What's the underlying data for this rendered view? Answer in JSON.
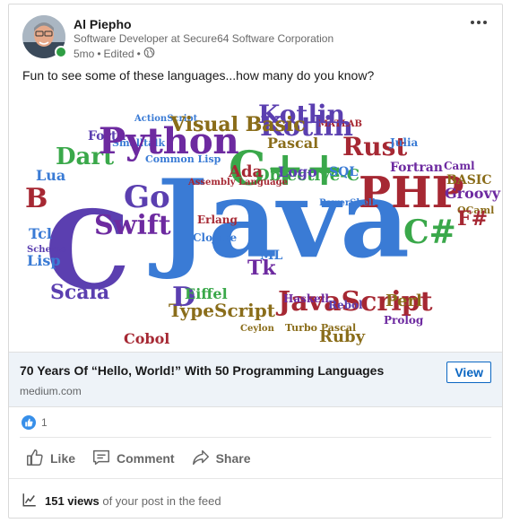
{
  "post": {
    "author": {
      "name": "Al Piepho",
      "headline": "Software Developer at Secure64 Software Corporation",
      "time": "5mo",
      "separator": "•",
      "edited": "Edited",
      "separator2": "•"
    },
    "text": "Fun to see some of these languages...how many do you know?",
    "link": {
      "title": "70 Years Of “Hello, World!” With 50 Programming Languages",
      "domain": "medium.com",
      "view_label": "View"
    },
    "reactions": {
      "count": "1"
    },
    "actions": {
      "like": "Like",
      "comment": "Comment",
      "share": "Share"
    },
    "views": {
      "count": "151 views",
      "suffix": "of your post in the feed"
    }
  },
  "word_cloud": {
    "words": [
      "Java",
      "C",
      "JavaScript",
      "PHP",
      "C++",
      "Python",
      "C#",
      "Swift",
      "Kotlin",
      "Dart",
      "Go",
      "Rust",
      "Scala",
      "TypeScript",
      "Objective-C",
      "Visual Basic",
      "Ruby",
      "Perl",
      "Lisp",
      "Lua",
      "Tcl",
      "Haskell",
      "Erlang",
      "Groovy",
      "D",
      "B",
      "Ada",
      "Cobol",
      "Fortran",
      "Julia",
      "SQL",
      "Logo",
      "Tk",
      "ML",
      "BASIC",
      "Smalltalk",
      "Common Lisp",
      "Pascal",
      "Eiffel",
      "Clojure",
      "Scheme",
      "Rebol",
      "Prolog",
      "Caml",
      "OCaml",
      "F#",
      "Forth",
      "MATLAB",
      "Assembly Language",
      "PowerShell",
      "Turbo Pascal",
      "ActionScript",
      "Ceylon",
      "Kotlin",
      "Python",
      "Visual Basic"
    ]
  },
  "colors": {
    "accent": "#0a66c2",
    "link_bar_bg": "#eef3f8",
    "presence": "#2f9e44",
    "like_badge": "#378fe9"
  },
  "icons": [
    "globe-icon",
    "more-icon",
    "like-reaction-icon",
    "like-icon",
    "comment-icon",
    "share-icon",
    "analytics-icon"
  ]
}
